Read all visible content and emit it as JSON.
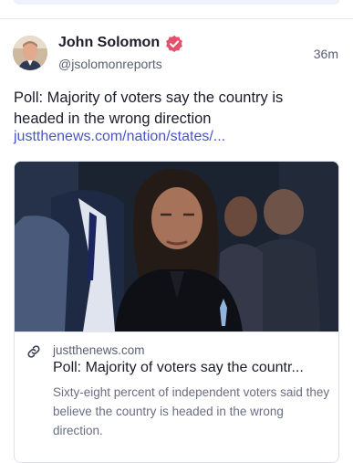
{
  "post": {
    "author": {
      "name": "John Solomon",
      "handle": "@jsolomonreports",
      "avatar_icon": "user-avatar-icon",
      "verified_icon": "verified-badge-icon",
      "verified_color": "#e2536b"
    },
    "timestamp": "36m",
    "text": "Poll: Majority of voters say the country is headed in the wrong direction",
    "link_text": "justthenews.com/nation/states/...",
    "link_color": "#4a56c6",
    "card": {
      "image_alt": "news-photo",
      "link_icon": "link-icon",
      "domain": "justthenews.com",
      "title": "Poll: Majority of voters say the countr...",
      "description": "Sixty-eight percent of independent voters said they believe the country is headed in the wrong direction."
    }
  }
}
